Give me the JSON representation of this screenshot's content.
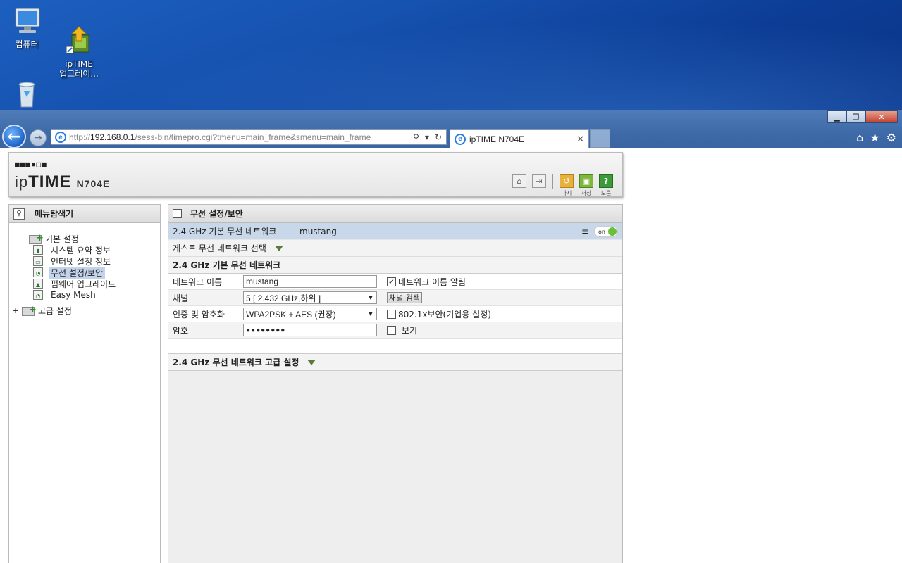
{
  "desktop": {
    "icons": [
      {
        "label": "컴퓨터"
      },
      {
        "label": "ipTIME\n업그레이..."
      }
    ]
  },
  "browser": {
    "url_prefix": "http://",
    "url_host": "192.168.0.1",
    "url_path": "/sess-bin/timepro.cgi?tmenu=main_frame&smenu=main_frame",
    "tab_title": "ipTIME N704E"
  },
  "router": {
    "logo_dots": "■■■▪□■",
    "brand_light": "ip",
    "brand_bold": "TIME",
    "model": "N704E",
    "header_buttons": [
      {
        "label": "다시"
      },
      {
        "label": "저장"
      },
      {
        "label": "도움"
      }
    ]
  },
  "left": {
    "title": "메뉴탐색기",
    "groups": [
      {
        "label": "기본 설정"
      },
      {
        "label": "고급 설정"
      }
    ],
    "items": [
      {
        "label": "시스템 요약 정보"
      },
      {
        "label": "인터넷 설정 정보"
      },
      {
        "label": "무선 설정/보안"
      },
      {
        "label": "펌웨어 업그레이드"
      },
      {
        "label": "Easy Mesh"
      }
    ]
  },
  "main": {
    "title": "무선 설정/보안",
    "net_name": "2.4 GHz 기본 무선 네트워크",
    "net_ssid": "mustang",
    "toggle_text": "on",
    "guest_label": "게스트 무선 네트워크 선택",
    "section_title": "2.4 GHz 기본 무선 네트워크",
    "rows": {
      "name_label": "네트워크 이름",
      "name_value": "mustang",
      "broadcast_label": "네트워크 이름 알림",
      "channel_label": "채널",
      "channel_value": "5 [ 2.432 GHz,하위 ]",
      "scan_button": "채널 검색",
      "auth_label": "인증 및 암호화",
      "auth_value": "WPA2PSK + AES (권장)",
      "enterprise_label": "802.1x보안(기업용 설정)",
      "password_label": "암호",
      "password_value": "●●●●●●●●",
      "show_label": "보기"
    },
    "advanced_title": "2.4 GHz 무선 네트워크 고급 설정"
  }
}
